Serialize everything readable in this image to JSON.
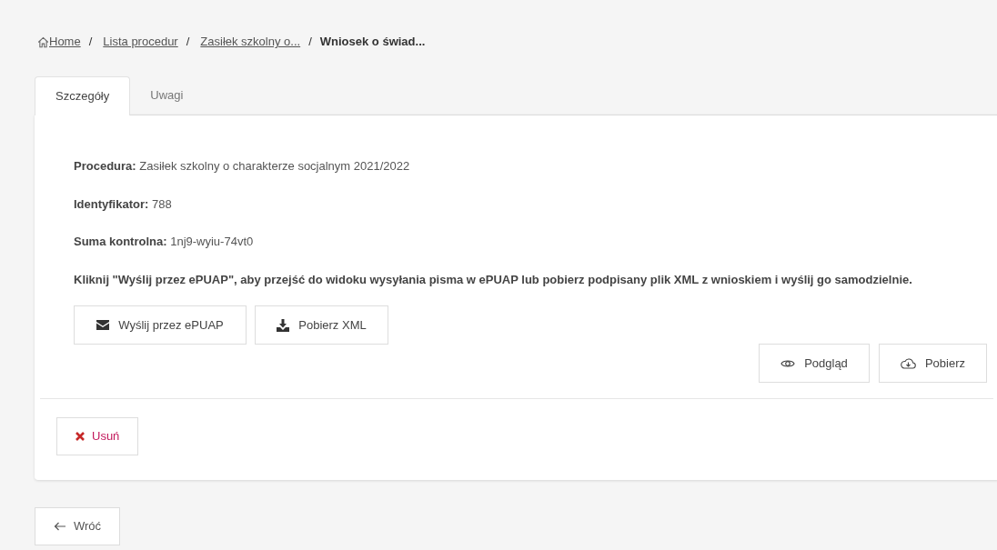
{
  "breadcrumb": [
    {
      "label": "Home",
      "kind": "home"
    },
    {
      "separator": "/",
      "label": "Lista procedur",
      "kind": "link"
    },
    {
      "separator": "/",
      "label": "Zasiłek szkolny o...",
      "kind": "link"
    },
    {
      "separator": "/",
      "label": "Wniosek o świad...",
      "kind": "current"
    }
  ],
  "tabs": [
    {
      "label": "Szczegóły",
      "selected": true
    },
    {
      "label": "Uwagi",
      "selected": false
    }
  ],
  "details": [
    {
      "label": "Procedura:",
      "value": "Zasiłek szkolny o charakterze socjalnym 2021/2022"
    },
    {
      "label": "Identyfikator:",
      "value": "788"
    },
    {
      "label": "Suma kontrolna:",
      "value": "1nj9-wyiu-74vt0"
    }
  ],
  "instruction": "Kliknij \"Wyślij przez ePUAP\", aby przejść do widoku wysyłania pisma w ePUAP lub pobierz podpisany plik XML z wnioskiem i wyślij go samodzielnie.",
  "actions": [
    {
      "label": "Wyślij przez ePUAP",
      "kind": "send"
    },
    {
      "label": "Pobierz XML",
      "kind": "download"
    }
  ],
  "file_actions": [
    {
      "label": "Podgląd",
      "kind": "preview"
    },
    {
      "label": "Pobierz",
      "kind": "download"
    }
  ],
  "delete_button": {
    "label": "Usuń"
  },
  "back_button": {
    "label": "Wróć"
  }
}
